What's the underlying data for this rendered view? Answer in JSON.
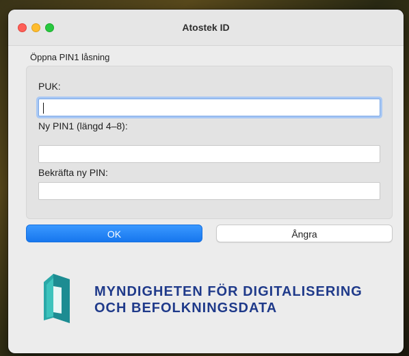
{
  "window": {
    "title": "Atostek ID"
  },
  "group": {
    "label": "Öppna PIN1 låsning"
  },
  "fields": {
    "puk": {
      "label": "PUK:",
      "value": ""
    },
    "new_pin": {
      "label": "Ny PIN1 (längd 4–8):",
      "value": ""
    },
    "confirm_pin": {
      "label": "Bekräfta ny PIN:",
      "value": ""
    }
  },
  "buttons": {
    "ok": "OK",
    "cancel": "Ångra"
  },
  "logo": {
    "line1": "MYNDIGHETEN FÖR DIGITALISERING",
    "line2": "OCH BEFOLKNINGSDATA"
  },
  "colors": {
    "accent": "#1a7cf3",
    "logo_blue": "#1f3a8a",
    "logo_teal": "#2aa8a8"
  }
}
